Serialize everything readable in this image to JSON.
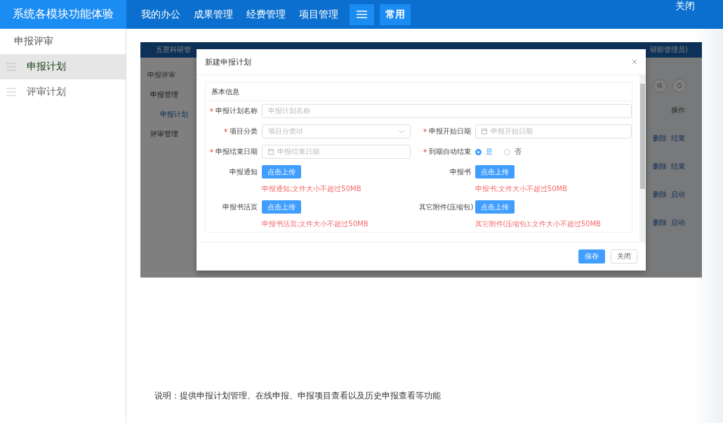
{
  "app_bar": {
    "title": "系统各模块功能体验",
    "nav": [
      {
        "kind": "text",
        "label": "我的办公",
        "highlighted": false
      },
      {
        "kind": "text",
        "label": "成果管理",
        "highlighted": false
      },
      {
        "kind": "text",
        "label": "经费管理",
        "highlighted": false
      },
      {
        "kind": "text",
        "label": "项目管理",
        "highlighted": false
      },
      {
        "kind": "menu",
        "highlighted": true
      },
      {
        "kind": "text",
        "label": "常用",
        "highlighted": true
      }
    ],
    "close": "关闭"
  },
  "sidebar": {
    "heading": "申报评审",
    "items": [
      {
        "label": "申报计划",
        "selected": true
      },
      {
        "label": "评审计划",
        "selected": false
      }
    ]
  },
  "preview": {
    "app_title": "五星科研管",
    "user": "研部管理员)",
    "breadcrumb": "申报评审",
    "menu": [
      {
        "kind": "group",
        "label": "申报管理",
        "selected": false
      },
      {
        "kind": "item",
        "label": "申报计划",
        "selected": true
      },
      {
        "kind": "group",
        "label": "评审管理",
        "selected": false
      }
    ],
    "column_header": "操作",
    "row_actions": [
      [
        "删除",
        "结束"
      ],
      [
        "删除",
        "结束"
      ],
      [
        "删除",
        "启动"
      ],
      [
        "删除",
        "启动"
      ]
    ],
    "dialog": {
      "title": "新建申报计划",
      "section": "基本信息",
      "fields": [
        {
          "kind": "text",
          "label": "申报计划名称",
          "required": true,
          "placeholder": "申报计划名称",
          "wide": true
        },
        {
          "kind": "select",
          "label": "项目分类",
          "required": true,
          "placeholder": "项目分类id"
        },
        {
          "kind": "date",
          "label": "申报开始日期",
          "required": true,
          "placeholder": "申报开始日期"
        },
        {
          "kind": "date",
          "label": "申报结束日期",
          "required": true,
          "placeholder": "申报结束日期"
        },
        {
          "kind": "radio",
          "label": "到期自动结束",
          "required": true,
          "options": [
            {
              "label": "是",
              "selected": true
            },
            {
              "label": "否",
              "selected": false
            }
          ]
        },
        {
          "kind": "upload",
          "label": "申报通知",
          "required": false,
          "button": "点击上传",
          "hint": "申报通知;文件大小不超过50MB"
        },
        {
          "kind": "upload",
          "label": "申报书",
          "required": false,
          "button": "点击上传",
          "hint": "申报书;文件大小不超过50MB"
        },
        {
          "kind": "upload",
          "label": "申报书活页",
          "required": false,
          "button": "点击上传",
          "hint": "申报书活页;文件大小不超过50MB"
        },
        {
          "kind": "upload",
          "label": "其它附件(压缩包)",
          "required": false,
          "button": "点击上传",
          "hint": "其它附件(压缩包);文件大小不超过50MB"
        }
      ],
      "buttons": [
        {
          "kind": "primary",
          "label": "保存"
        },
        {
          "kind": "default",
          "label": "关闭"
        }
      ]
    }
  },
  "caption": "说明：提供申报计划管理、在线申报、申报项目查看以及历史申报查看等功能"
}
